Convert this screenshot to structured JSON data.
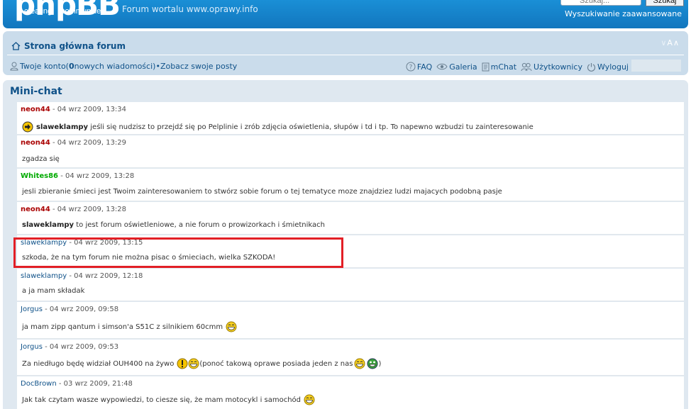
{
  "header": {
    "logo_main": "phpBB",
    "logo_sub_left": "creating",
    "logo_sub_right": "communities",
    "site_description": "Forum wortalu www.oprawy.info",
    "search_placeholder": "Szukaj...",
    "search_button": "Szukaj",
    "advanced_search": "Wyszukiwanie zaawansowane"
  },
  "nav": {
    "breadcrumb": "Strona główna forum",
    "font_size": "A",
    "account": "Twoje konto",
    "paren_open": " (",
    "new_count": "0",
    "new_messages": " nowych wiadomości)",
    "bullet": " • ",
    "your_posts": "Zobacz swoje posty",
    "faq": "FAQ",
    "gallery": "Galeria",
    "mchat": "mChat",
    "users": "Użytkownicy",
    "logout": "Wyloguj"
  },
  "chat": {
    "title": "Mini-chat",
    "messages": [
      {
        "user": "neon44",
        "color": "#aa0000",
        "date": " - 04 wrz 2009, 13:34",
        "prefix": "",
        "bold": "slaweklampy",
        "text": " jeśli się nudzisz to przejdź się po Pelplinie i zrób zdjęcia oświetlenia, słupów i td i tp. To napewno wzbudzi tu zainteresowanie",
        "suffix": ""
      },
      {
        "user": "neon44",
        "color": "#aa0000",
        "date": " - 04 wrz 2009, 13:29",
        "prefix": "",
        "bold": "",
        "text": "zgadza się",
        "suffix": ""
      },
      {
        "user": "Whites86",
        "color": "#00aa00",
        "date": " - 04 wrz 2009, 13:28",
        "prefix": "",
        "bold": "",
        "text": "jesli zbieranie śmieci jest Twoim zainteresowaniem to stwórz sobie forum o tej tematyce moze znajdziez ludzi majacych podobną pasje",
        "suffix": ""
      },
      {
        "user": "neon44",
        "color": "#aa0000",
        "date": " - 04 wrz 2009, 13:28",
        "prefix": "",
        "bold": "slaweklampy",
        "text": " to jest forum oświetleniowe, a nie forum o prowizorkach i śmietnikach",
        "suffix": ""
      },
      {
        "user": "slaweklampy",
        "color": "#105289",
        "date": " - 04 wrz 2009, 13:15",
        "prefix": "",
        "bold": "",
        "text": "szkoda, że na tym forum nie można pisac o śmieciach, wielka SZKODA!",
        "suffix": ""
      },
      {
        "user": "slaweklampy",
        "color": "#105289",
        "date": " - 04 wrz 2009, 12:18",
        "prefix": "",
        "bold": "",
        "text": "a ja mam składak",
        "suffix": ""
      },
      {
        "user": "Jorgus",
        "color": "#105289",
        "date": " - 04 wrz 2009, 09:58",
        "prefix": "",
        "bold": "",
        "text": "ja mam zipp qantum i simson'a S51C z silnikiem 60cmm",
        "suffix": ""
      },
      {
        "user": "Jorgus",
        "color": "#105289",
        "date": " - 04 wrz 2009, 09:53",
        "prefix": "",
        "bold": "",
        "text": "Za niedługo będę widział OUH400 na żywo",
        "text2": "(ponoć takową oprawe posiada jeden z nas",
        "suffix": ")"
      },
      {
        "user": "DocBrown",
        "color": "#105289",
        "date": " - 03 wrz 2009, 21:48",
        "prefix": "",
        "bold": "",
        "text": "Jak tak czytam wasze wypowiedzi, to ciesze się, że mam motocykl i samochód",
        "suffix": ""
      }
    ]
  },
  "colors": {
    "header_blue": "#1276be",
    "nav_bg": "#cadceb",
    "panel_bg": "#dfe8f0",
    "link": "#105289",
    "highlight": "#e21f26"
  }
}
